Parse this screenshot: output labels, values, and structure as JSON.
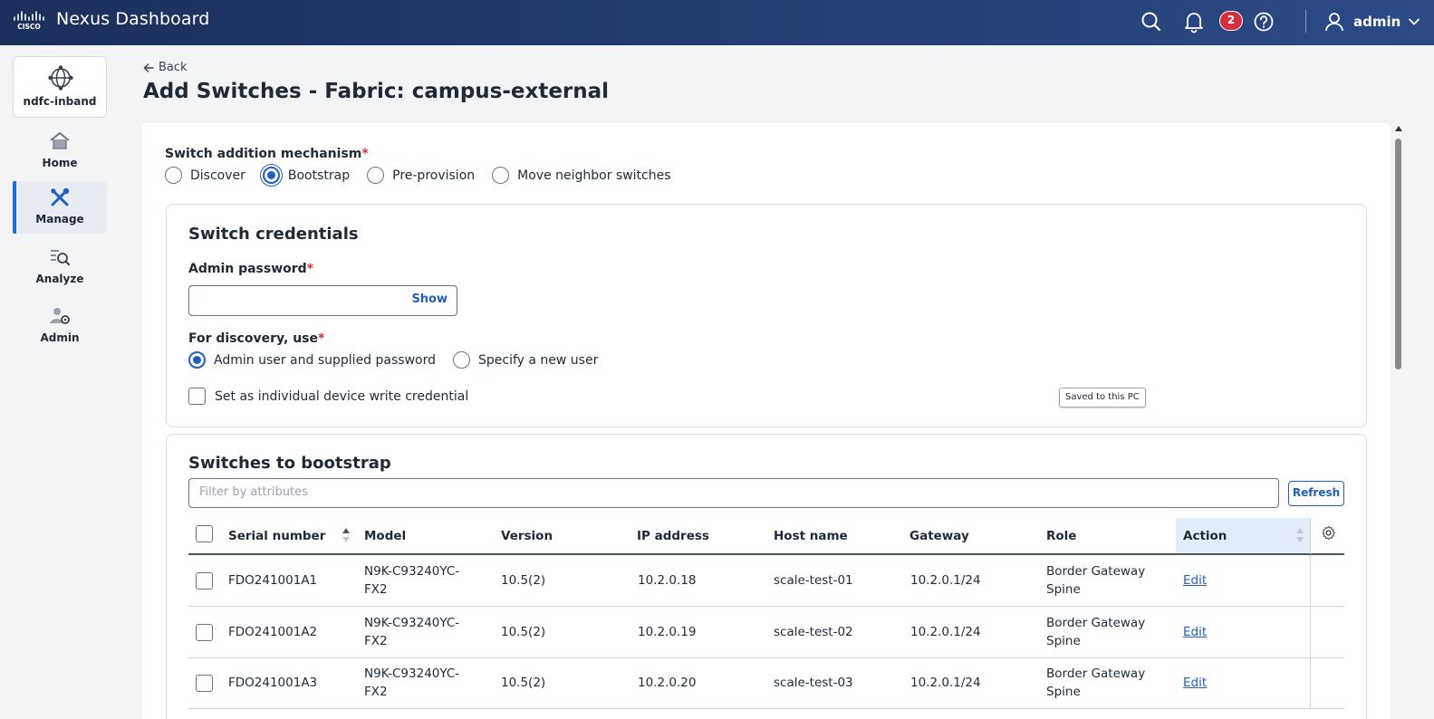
{
  "header": {
    "app_title": "Nexus Dashboard",
    "notification_count": "2",
    "user_name": "admin"
  },
  "sidebar": {
    "site_label": "ndfc-inband",
    "items": [
      {
        "label": "Home",
        "icon": "home-icon"
      },
      {
        "label": "Manage",
        "icon": "tools-icon",
        "active": true
      },
      {
        "label": "Analyze",
        "icon": "analyze-icon"
      },
      {
        "label": "Admin",
        "icon": "admin-icon"
      }
    ]
  },
  "page": {
    "back_label": "Back",
    "title": "Add Switches - Fabric: campus-external"
  },
  "mechanism": {
    "label": "Switch addition mechanism",
    "required": "*",
    "options": [
      "Discover",
      "Bootstrap",
      "Pre-provision",
      "Move neighbor switches"
    ],
    "selected": "Bootstrap"
  },
  "credentials": {
    "title": "Switch credentials",
    "password_label": "Admin password",
    "password_value": "",
    "show_label": "Show",
    "discovery_label": "For discovery, use",
    "discovery_options": [
      "Admin user and supplied password",
      "Specify a new user"
    ],
    "discovery_selected": "Admin user and supplied password",
    "write_credential_label": "Set as individual device write credential",
    "tooltip": "Saved to this PC"
  },
  "bootstrap": {
    "title": "Switches to bootstrap",
    "filter_placeholder": "Filter by attributes",
    "refresh_label": "Refresh",
    "columns": [
      "Serial number",
      "Model",
      "Version",
      "IP address",
      "Host name",
      "Gateway",
      "Role",
      "Action"
    ],
    "rows": [
      {
        "serial": "FDO241001A1",
        "model_1": "N9K-C93240YC-",
        "model_2": "FX2",
        "version": "10.5(2)",
        "ip": "10.2.0.18",
        "host": "scale-test-01",
        "gateway": "10.2.0.1/24",
        "role_1": "Border Gateway",
        "role_2": "Spine",
        "action": "Edit"
      },
      {
        "serial": "FDO241001A2",
        "model_1": "N9K-C93240YC-",
        "model_2": "FX2",
        "version": "10.5(2)",
        "ip": "10.2.0.19",
        "host": "scale-test-02",
        "gateway": "10.2.0.1/24",
        "role_1": "Border Gateway",
        "role_2": "Spine",
        "action": "Edit"
      },
      {
        "serial": "FDO241001A3",
        "model_1": "N9K-C93240YC-",
        "model_2": "FX2",
        "version": "10.5(2)",
        "ip": "10.2.0.20",
        "host": "scale-test-03",
        "gateway": "10.2.0.1/24",
        "role_1": "Border Gateway",
        "role_2": "Spine",
        "action": "Edit"
      }
    ]
  }
}
